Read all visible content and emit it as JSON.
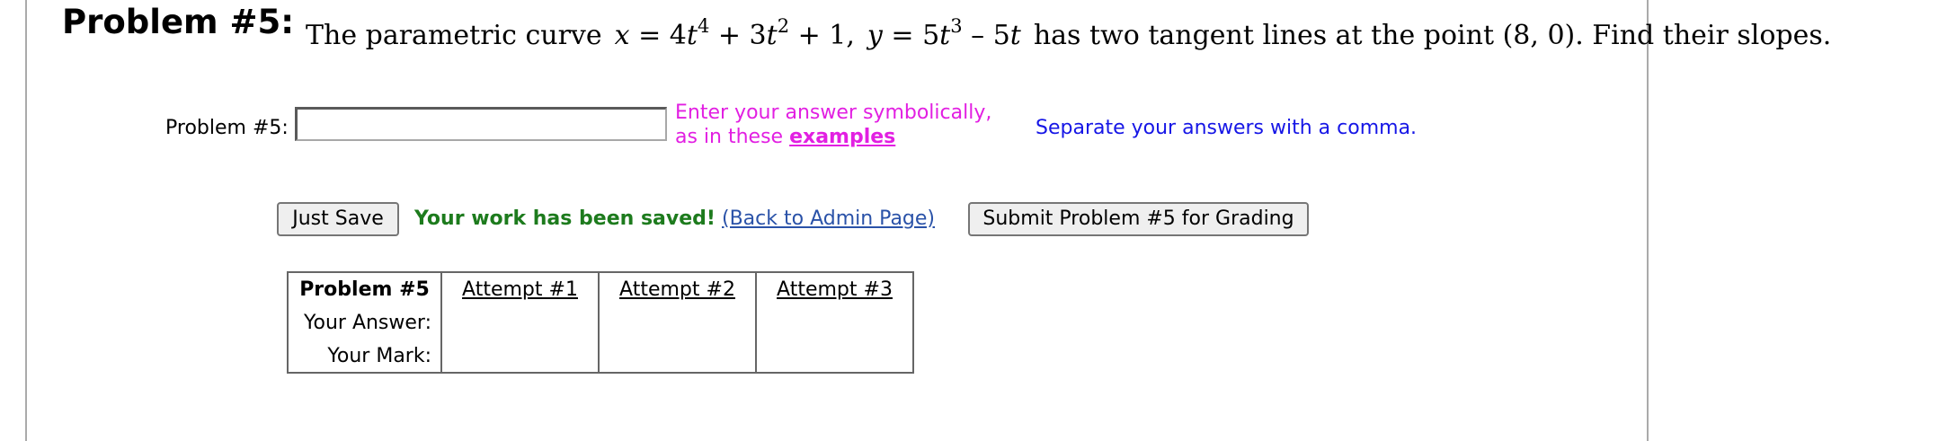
{
  "problem": {
    "heading": "Problem #5:",
    "statement": {
      "intro": "The parametric curve",
      "x_lhs": "x",
      "x_rhs_a": "4",
      "x_var_a": "t",
      "x_exp_a": "4",
      "x_plus_a": "+ 3",
      "x_var_b": "t",
      "x_exp_b": "2",
      "x_tail": "+ 1,",
      "y_lhs": "y",
      "y_rhs_a": "5",
      "y_var_a": "t",
      "y_exp_a": "3",
      "y_minus": "– 5",
      "y_var_b": "t",
      "mid": "has two tangent lines at the point",
      "point": "(8, 0)",
      "outro": ". Find their slopes."
    }
  },
  "answer": {
    "label": "Problem #5:",
    "value": "",
    "placeholder": "",
    "hint_line1": "Enter your answer symbolically,",
    "hint_line2": "as in these",
    "examples_link": "examples",
    "separate_note": "Separate your answers with a comma."
  },
  "actions": {
    "save_label": "Just Save",
    "saved_message": "Your work has been saved!",
    "admin_link": "(Back to Admin Page)",
    "submit_label": "Submit Problem #5 for Grading"
  },
  "attempts": {
    "header": "Problem #5",
    "columns": [
      "Attempt #1",
      "Attempt #2",
      "Attempt #3"
    ],
    "rows": [
      {
        "label": "Your Answer:",
        "values": [
          "",
          "",
          ""
        ]
      },
      {
        "label": "Your Mark:",
        "values": [
          "",
          "",
          ""
        ]
      }
    ]
  }
}
